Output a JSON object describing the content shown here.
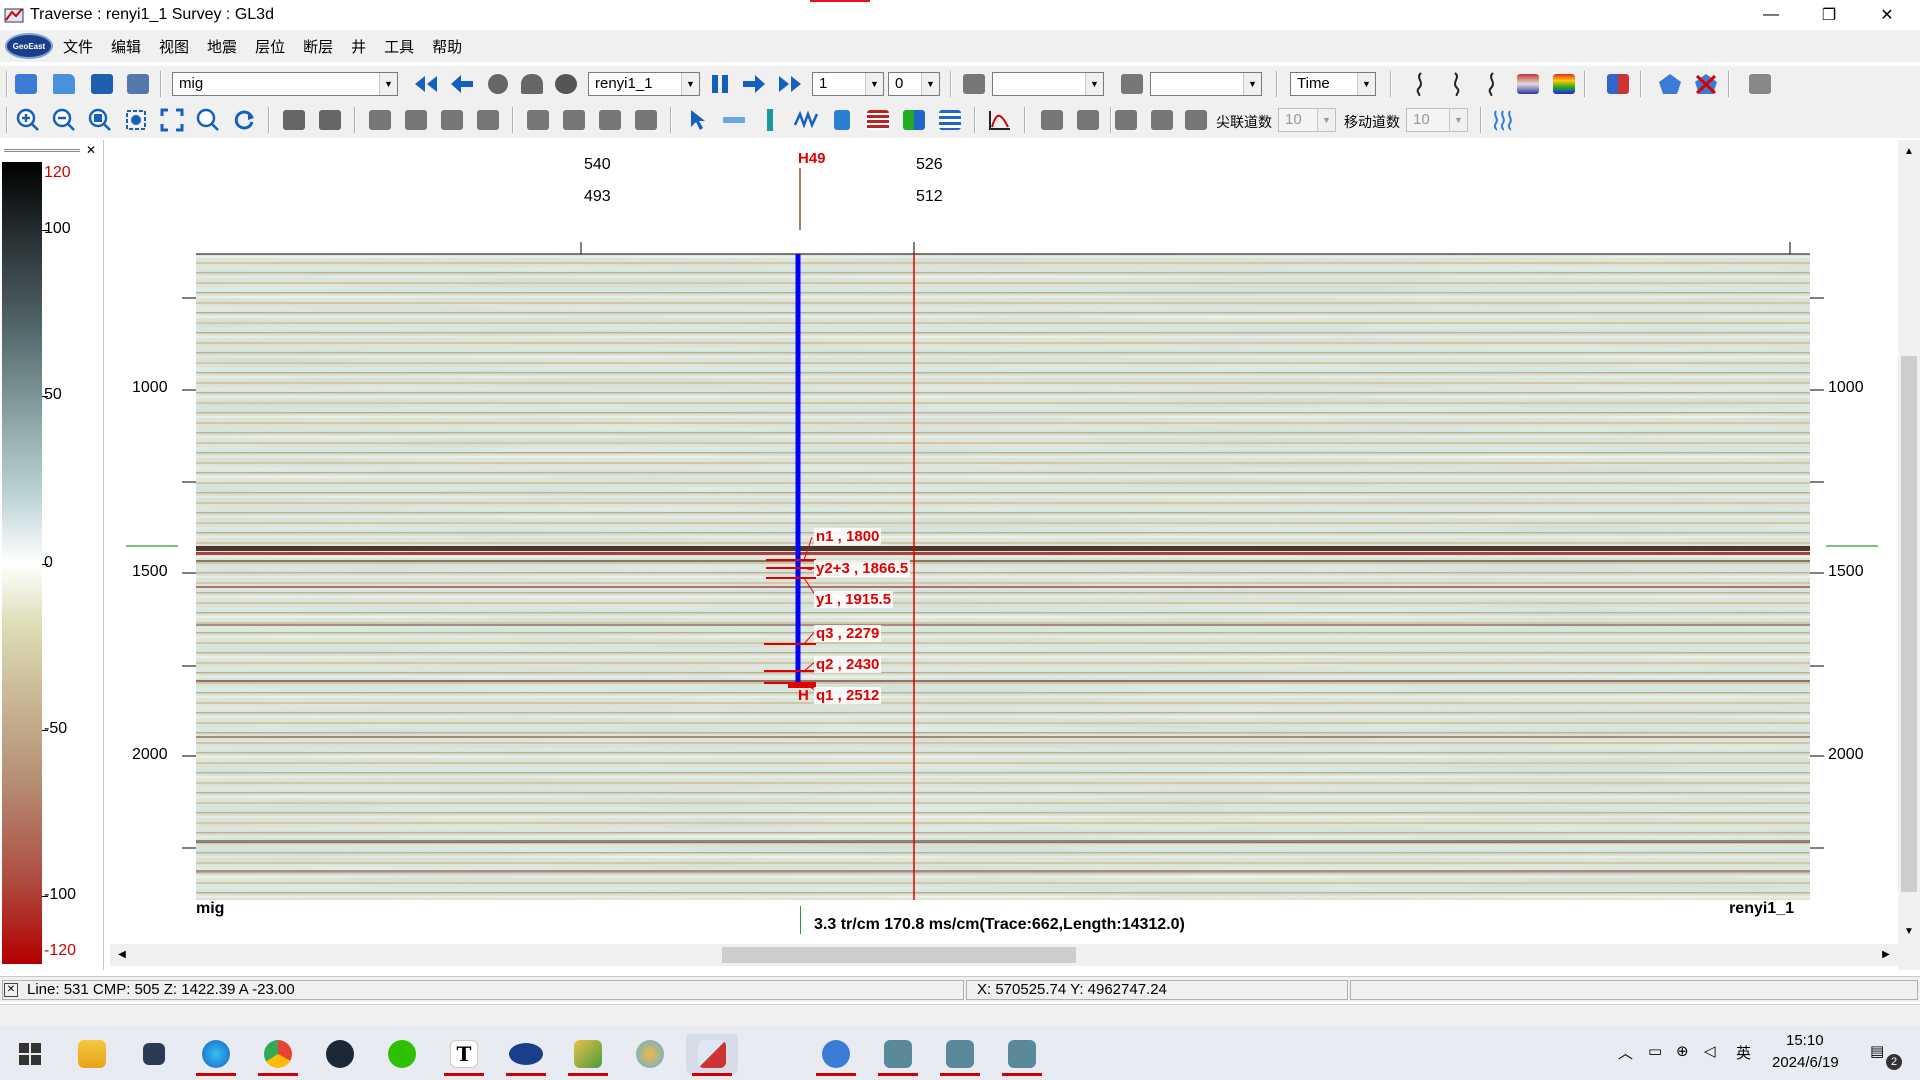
{
  "window": {
    "title": "Traverse : renyi1_1  Survey : GL3d",
    "controls": [
      "—",
      "❐",
      "✕"
    ]
  },
  "menu": {
    "logo_text": "GeoEast",
    "items": [
      "文件",
      "编辑",
      "视图",
      "地震",
      "层位",
      "断层",
      "井",
      "工具",
      "帮助"
    ]
  },
  "toolbar1": {
    "data_combo": "mig",
    "line_combo": "renyi1_1",
    "step_combo": "1",
    "offset_combo": "0",
    "combo_a": "",
    "combo_b": "",
    "domain_combo": "Time"
  },
  "toolbar2": {
    "label_gain": "尖联道数",
    "gain_value": "10",
    "label_move": "移动道数",
    "move_value": "10"
  },
  "colorbar": {
    "ticks": [
      "120",
      "100",
      "50",
      "0",
      "-50",
      "-100",
      "-120"
    ],
    "colors": {
      "top": "#000000",
      "mid": "#ffffff",
      "bottom": "#b30000"
    }
  },
  "section": {
    "top_labels": {
      "row1": [
        "540",
        "526"
      ],
      "row2": [
        "493",
        "512"
      ]
    },
    "well_name": "H49",
    "well_bottom_label": "H",
    "y_ticks": [
      "1000",
      "1500",
      "2000"
    ],
    "bottom_left": "mig",
    "bottom_right": "renyi1_1",
    "scale_text": "3.3 tr/cm 170.8 ms/cm(Trace:662,Length:14312.0)",
    "markers": [
      {
        "label": "n1 , 1800"
      },
      {
        "label": "y2+3 , 1866.5"
      },
      {
        "label": "y1 , 1915.5"
      },
      {
        "label": "q3 , 2279"
      },
      {
        "label": "q2 , 2430"
      },
      {
        "label": "q1 , 2512"
      }
    ],
    "colors": {
      "well": "#0000ff",
      "marker": "#e00000",
      "cursor": "#e00000"
    }
  },
  "status": {
    "line_info": "Line:  531  CMP:  505  Z:  1422.39  A  -23.00",
    "xy_info": "X:  570525.74   Y:  4962747.24"
  },
  "taskbar": {
    "apps": [
      "windows-start",
      "file-explorer",
      "app-cat",
      "edge",
      "chrome",
      "steam",
      "wechat",
      "typora",
      "geoeast",
      "app-map",
      "app-clover",
      "traverse",
      "search-app",
      "app-window-1",
      "app-window-2",
      "app-window-3"
    ],
    "tray": {
      "time": "15:10",
      "date": "2024/6/19",
      "ime": "英",
      "notification_count": "2"
    }
  }
}
